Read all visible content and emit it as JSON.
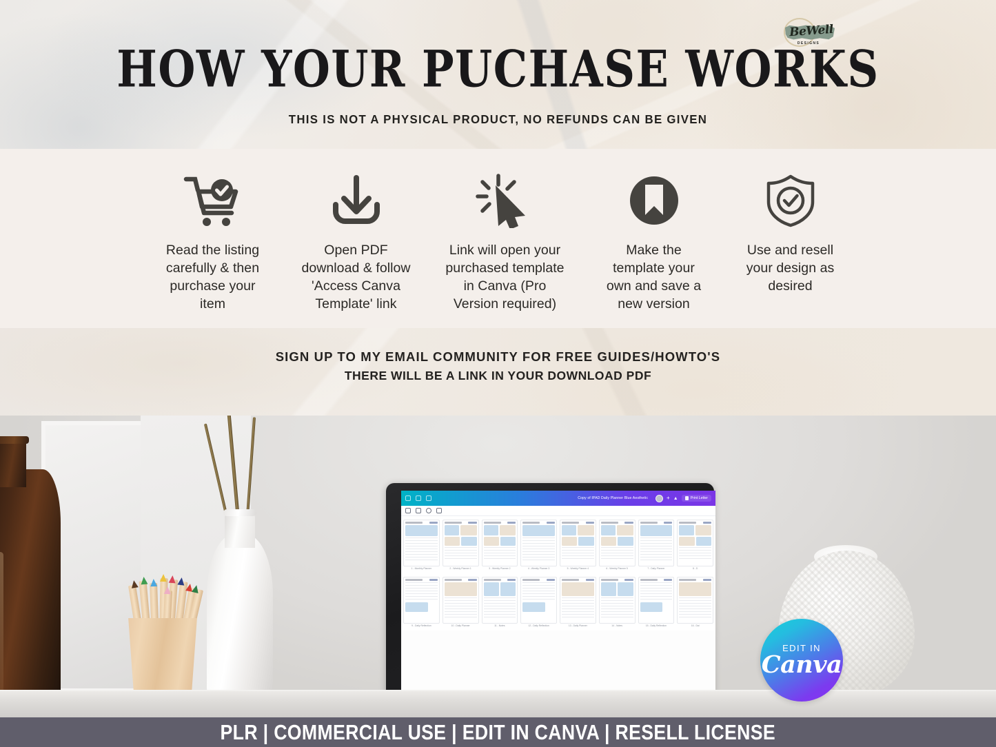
{
  "header": {
    "title": "HOW YOUR PUCHASE WORKS",
    "subtitle": "THIS IS NOT A PHYSICAL PRODUCT, NO REFUNDS CAN BE GIVEN",
    "logo": {
      "script": "BeWell",
      "sub": "DESIGNS"
    }
  },
  "steps": [
    {
      "icon": "cart-check-icon",
      "caption": "Read the listing carefully & then purchase your item"
    },
    {
      "icon": "download-icon",
      "caption": "Open PDF download & follow 'Access Canva Template' link"
    },
    {
      "icon": "click-cursor-icon",
      "caption": "Link will open your purchased template in Canva (Pro Version required)"
    },
    {
      "icon": "bookmark-circle-icon",
      "caption": "Make the template your own and save a new version"
    },
    {
      "icon": "shield-check-icon",
      "caption": "Use and resell your design as desired"
    }
  ],
  "email": {
    "line1": "SIGN UP TO MY EMAIL COMMUNITY FOR FREE GUIDES/HOWTO'S",
    "line2": "THERE WILL BE A LINK IN YOUR DOWNLOAD PDF"
  },
  "laptop": {
    "doc_title": "Copy of IPAD Daily Planner Blue Aesthetic",
    "print_button": "Print Letter",
    "pages_row1": [
      "1 - Monthly Planner",
      "2 - Weekly Planner 1",
      "3 - Weekly Planner 2",
      "4 - Weekly Planner 3",
      "5 - Weekly Planner 4",
      "6 - Weekly Planner 5",
      "7 - Daily Planner",
      "8 - D"
    ],
    "pages_row2": [
      "9 - Daily Reflection",
      "10 - Daily Planner",
      "11 - Notes",
      "12 - Daily Reflection",
      "13 - Daily Planner",
      "14 - Notes",
      "15 - Daily Reflection",
      "16 - Dai"
    ]
  },
  "badge": {
    "line1": "EDIT IN",
    "line2": "Canva"
  },
  "footer": {
    "text": "PLR | COMMERCIAL USE | EDIT IN CANVA | RESELL LICENSE"
  },
  "colors": {
    "paper": "#efe9e2",
    "strip": "#f4efeb",
    "ink": "#2b2926",
    "footer_bar": "#605e6b",
    "logo_green": "#7d9485",
    "canva_teal": "#15d3d8",
    "canva_purple": "#8d2ff2"
  }
}
